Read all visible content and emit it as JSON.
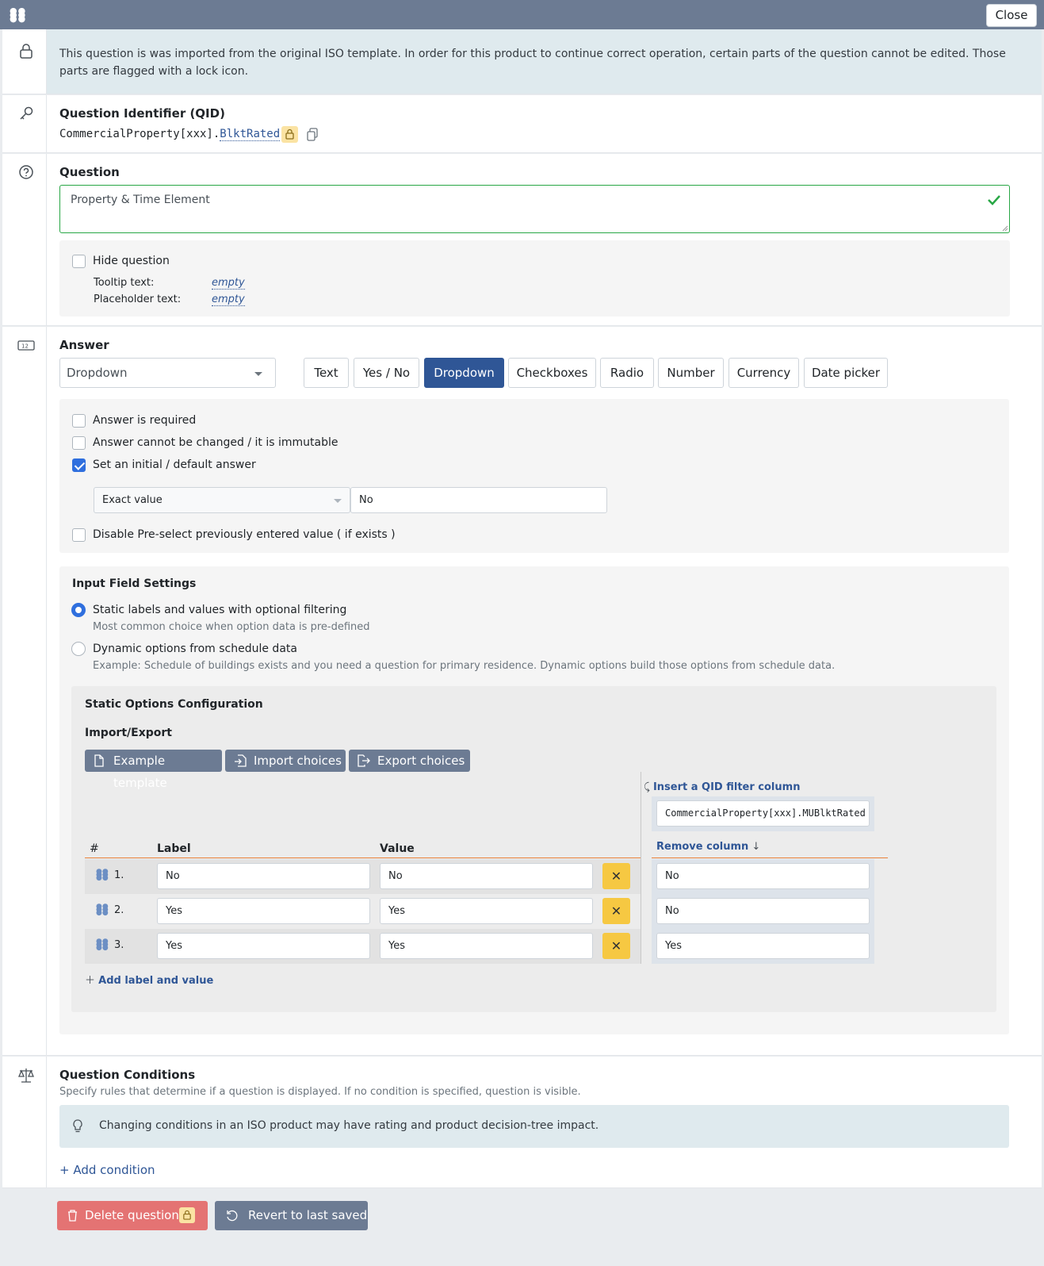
{
  "window": {
    "close_label": "Close"
  },
  "notice": {
    "text": "This question is was imported from the original ISO template. In order for this product to continue correct operation, certain parts of the question cannot be edited. Those parts are flagged with a lock icon."
  },
  "qid": {
    "title": "Question Identifier (QID)",
    "prefix": "CommercialProperty[xxx].",
    "suffix": "BlktRated"
  },
  "question": {
    "title": "Question",
    "value": "Property & Time Element",
    "hide_label": "Hide question",
    "tooltip_label": "Tooltip text:",
    "tooltip_value": "empty",
    "placeholder_label": "Placeholder text:",
    "placeholder_value": "empty"
  },
  "answer": {
    "title": "Answer",
    "selected_type": "Dropdown",
    "types": [
      "Text",
      "Yes / No",
      "Dropdown",
      "Checkboxes",
      "Radio",
      "Number",
      "Currency",
      "Date picker"
    ],
    "required_label": "Answer is required",
    "immutable_label": "Answer cannot be changed / it is immutable",
    "default_label": "Set an initial / default answer",
    "default_mode": "Exact value",
    "default_value": "No",
    "disable_preselect_label": "Disable Pre-select previously entered value ( if exists )"
  },
  "input_settings": {
    "title": "Input Field Settings",
    "static_label": "Static labels and values with optional filtering",
    "static_hint": "Most common choice when option data is pre-defined",
    "dynamic_label": "Dynamic options from schedule data",
    "dynamic_hint": "Example: Schedule of buildings exists and you need a question for primary residence. Dynamic options build those options from schedule data."
  },
  "static_config": {
    "title": "Static Options Configuration",
    "import_export": "Import/Export",
    "example_btn": "Example template",
    "import_btn": "Import choices",
    "export_btn": "Export choices",
    "insert_filter": "Insert a QID filter column",
    "filter_qid": "CommercialProperty[xxx].MUBlktRated",
    "remove_column": "Remove column",
    "col_hash": "#",
    "col_label": "Label",
    "col_value": "Value",
    "rows": [
      {
        "num": "1.",
        "label": "No",
        "value": "No",
        "filter": "No"
      },
      {
        "num": "2.",
        "label": "Yes",
        "value": "Yes",
        "filter": "No"
      },
      {
        "num": "3.",
        "label": "Yes",
        "value": "Yes",
        "filter": "Yes"
      }
    ],
    "add_label": "Add label and value"
  },
  "conditions": {
    "title": "Question Conditions",
    "subtitle": "Specify rules that determine if a question is displayed. If no condition is specified, question is visible.",
    "tip": "Changing conditions in an ISO product may have rating and product decision-tree impact.",
    "add": "+ Add condition"
  },
  "footer": {
    "delete_label": "Delete question",
    "revert_label": "Revert to last saved"
  },
  "colors": {
    "accent": "#2f5696",
    "topbar": "#6c7b93",
    "danger": "#e47373",
    "warning": "#f6c842",
    "success": "#28a745"
  }
}
